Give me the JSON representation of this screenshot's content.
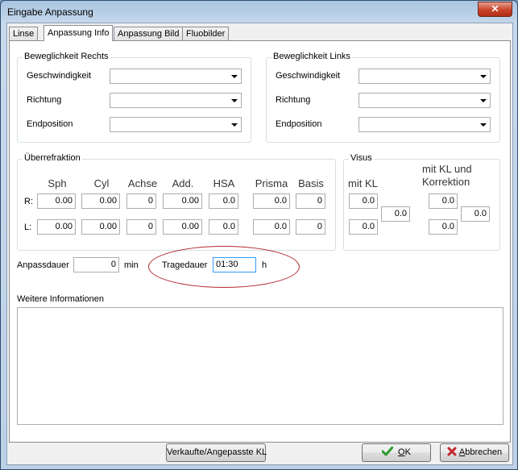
{
  "window": {
    "title": "Eingabe Anpassung",
    "close_glyph": "✕"
  },
  "tabs": [
    "Linse",
    "Anpassung Info",
    "Anpassung Bild",
    "Fluobilder"
  ],
  "mobility_right": {
    "title": "Beweglichkeit Rechts",
    "fields": [
      "Geschwindigkeit",
      "Richtung",
      "Endposition"
    ]
  },
  "mobility_left": {
    "title": "Beweglichkeit Links",
    "fields": [
      "Geschwindigkeit",
      "Richtung",
      "Endposition"
    ]
  },
  "refraction": {
    "title": "Überrefraktion",
    "headers": [
      "Sph",
      "Cyl",
      "Achse",
      "Add.",
      "HSA",
      "Prisma",
      "Basis"
    ],
    "row_labels": [
      "R:",
      "L:"
    ],
    "right": [
      "0.00",
      "0.00",
      "0",
      "0.00",
      "0.0",
      "0.0",
      "0"
    ],
    "left": [
      "0.00",
      "0.00",
      "0",
      "0.00",
      "0.0",
      "0.0",
      "0"
    ]
  },
  "visus": {
    "title": "Visus",
    "col1_header": "mit KL",
    "col2_header": "mit KL und Korrektion",
    "col1_r": "0.0",
    "col1_l": "0.0",
    "col1_both": "0.0",
    "col2_r": "0.0",
    "col2_l": "0.0",
    "col2_both": "0.0"
  },
  "anpassdauer": {
    "label": "Anpassdauer",
    "value": "0",
    "unit": "min"
  },
  "tragedauer": {
    "label": "Tragedauer",
    "value": "01:30",
    "unit": "h"
  },
  "info": {
    "label": "Weitere Informationen",
    "value": ""
  },
  "buttons": {
    "sold": "Verkaufte/Angepasste KL",
    "ok_underlined": "O",
    "ok_rest": "K",
    "cancel_underlined": "A",
    "cancel_rest": "bbrechen"
  },
  "colors": {
    "annotation_ellipse": "#b3272d",
    "ok_check": "#2e9b2e",
    "cancel_x": "#c0282d"
  }
}
